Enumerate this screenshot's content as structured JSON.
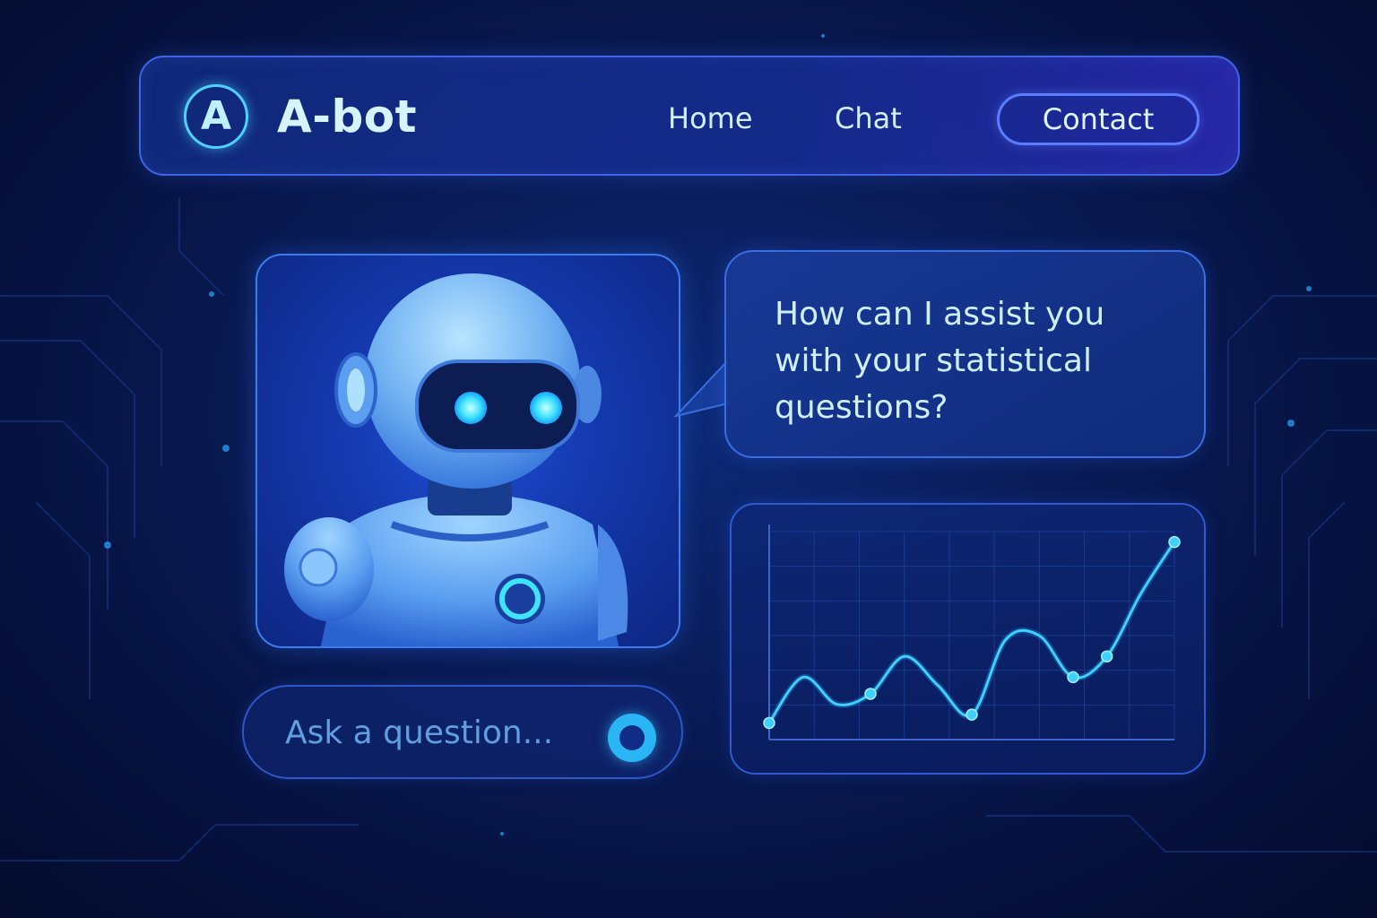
{
  "app": {
    "logo_letter": "A",
    "brand": "A-bot"
  },
  "nav": {
    "items": [
      {
        "label": "Home"
      },
      {
        "label": "Chat"
      }
    ],
    "contact_label": "Contact"
  },
  "bot_message": {
    "text": "How can I assist you with your statistical questions?"
  },
  "ask": {
    "placeholder": "Ask a question..."
  },
  "icons": {
    "logo": "logo-icon",
    "robot": "robot-avatar",
    "send": "send-icon"
  },
  "colors": {
    "accent_cyan": "#2ab5f5",
    "accent_blue": "#3f64e8",
    "background": "#061240"
  },
  "chart_data": {
    "type": "line",
    "title": "",
    "xlabel": "",
    "ylabel": "",
    "grid": true,
    "x": [
      0,
      1,
      2,
      3,
      4,
      5,
      6,
      7,
      8,
      9,
      10,
      11,
      12
    ],
    "series": [
      {
        "values": [
          8,
          30,
          17,
          22,
          40,
          26,
          12,
          48,
          50,
          30,
          40,
          70,
          95
        ],
        "markers": [
          0,
          3,
          6,
          9,
          10,
          12
        ]
      }
    ],
    "ylim": [
      0,
      100
    ]
  }
}
